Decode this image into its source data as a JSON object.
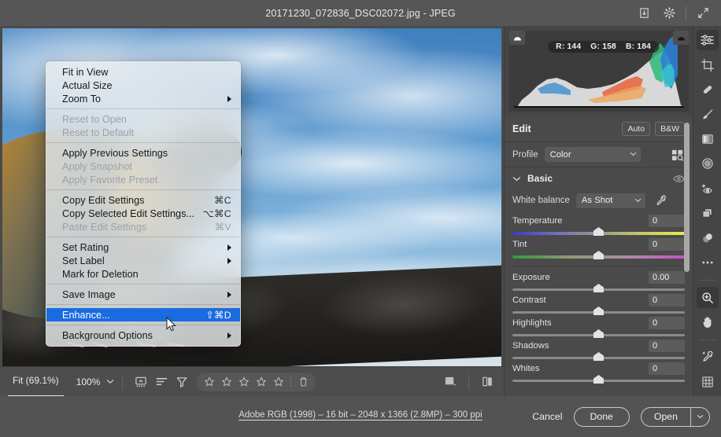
{
  "titlebar": {
    "title": "20171230_072836_DSC02072.jpg  -  JPEG",
    "icons": [
      "save-icon",
      "gear-icon",
      "expand-icon"
    ]
  },
  "context_menu": {
    "items": [
      {
        "label": "Fit in View",
        "shortcut": "",
        "disabled": false,
        "submenu": false,
        "selected": false
      },
      {
        "label": "Actual Size",
        "shortcut": "",
        "disabled": false,
        "submenu": false,
        "selected": false
      },
      {
        "label": "Zoom To",
        "shortcut": "",
        "disabled": false,
        "submenu": true,
        "selected": false
      },
      {
        "separator": true
      },
      {
        "label": "Reset to Open",
        "shortcut": "",
        "disabled": true,
        "submenu": false,
        "selected": false
      },
      {
        "label": "Reset to Default",
        "shortcut": "",
        "disabled": true,
        "submenu": false,
        "selected": false
      },
      {
        "separator": true
      },
      {
        "label": "Apply Previous Settings",
        "shortcut": "",
        "disabled": false,
        "submenu": false,
        "selected": false
      },
      {
        "label": "Apply Snapshot",
        "shortcut": "",
        "disabled": true,
        "submenu": false,
        "selected": false
      },
      {
        "label": "Apply Favorite Preset",
        "shortcut": "",
        "disabled": true,
        "submenu": false,
        "selected": false
      },
      {
        "separator": true
      },
      {
        "label": "Copy Edit Settings",
        "shortcut": "⌘C",
        "disabled": false,
        "submenu": false,
        "selected": false
      },
      {
        "label": "Copy Selected Edit Settings...",
        "shortcut": "⌥⌘C",
        "disabled": false,
        "submenu": false,
        "selected": false
      },
      {
        "label": "Paste Edit Settings",
        "shortcut": "⌘V",
        "disabled": true,
        "submenu": false,
        "selected": false
      },
      {
        "separator": true
      },
      {
        "label": "Set Rating",
        "shortcut": "",
        "disabled": false,
        "submenu": true,
        "selected": false
      },
      {
        "label": "Set Label",
        "shortcut": "",
        "disabled": false,
        "submenu": true,
        "selected": false
      },
      {
        "label": "Mark for Deletion",
        "shortcut": "",
        "disabled": false,
        "submenu": false,
        "selected": false
      },
      {
        "separator": true
      },
      {
        "label": "Save Image",
        "shortcut": "",
        "disabled": false,
        "submenu": true,
        "selected": false
      },
      {
        "separator": true
      },
      {
        "label": "Enhance...",
        "shortcut": "⇧⌘D",
        "disabled": false,
        "submenu": false,
        "selected": true
      },
      {
        "separator": true
      },
      {
        "label": "Background Options",
        "shortcut": "",
        "disabled": false,
        "submenu": true,
        "selected": false
      }
    ],
    "highlight_color": "#1a6be0"
  },
  "image_toolbar": {
    "fit_label": "Fit (69.1%)",
    "zoom_value": "100%",
    "icons": [
      "fullscreen-toggle-icon",
      "sort-icon",
      "filter-icon",
      "trash-icon",
      "fill-view-icon",
      "before-after-icon"
    ],
    "stars": 5,
    "rating": 0
  },
  "histogram": {
    "readout": {
      "r_label": "R: 144",
      "g_label": "G: 158",
      "b_label": "B: 184"
    },
    "rgb": {
      "r": 144,
      "g": 158,
      "b": 184
    },
    "shadow_clip_icon": "shadow-clipping-icon",
    "highlight_clip_icon": "highlight-clipping-icon"
  },
  "edit_panel": {
    "title": "Edit",
    "auto_label": "Auto",
    "bw_label": "B&W",
    "profile_label": "Profile",
    "profile_value": "Color",
    "browse_profiles_icon": "profile-browser-icon",
    "section": {
      "name": "Basic",
      "expanded": true,
      "visibility_icon": "eye-icon"
    },
    "white_balance_label": "White balance",
    "white_balance_value": "As Shot",
    "eyedropper_icon": "eyedropper-icon",
    "sliders": [
      {
        "name": "Temperature",
        "value": "0",
        "pos": 50,
        "track": "temp"
      },
      {
        "name": "Tint",
        "value": "0",
        "pos": 50,
        "track": "tint"
      },
      {
        "name": "Exposure",
        "value": "0.00",
        "pos": 50,
        "track": "plain"
      },
      {
        "name": "Contrast",
        "value": "0",
        "pos": 50,
        "track": "plain"
      },
      {
        "name": "Highlights",
        "value": "0",
        "pos": 50,
        "track": "plain"
      },
      {
        "name": "Shadows",
        "value": "0",
        "pos": 50,
        "track": "plain"
      },
      {
        "name": "Whites",
        "value": "0",
        "pos": 50,
        "track": "plain"
      }
    ]
  },
  "tool_rail": {
    "tools": [
      {
        "icon": "edit-sliders-icon",
        "active": true
      },
      {
        "icon": "crop-icon",
        "active": false
      },
      {
        "icon": "healing-brush-icon",
        "active": false
      },
      {
        "icon": "adjustment-brush-icon",
        "active": false
      },
      {
        "icon": "linear-gradient-icon",
        "active": false
      },
      {
        "icon": "radial-gradient-icon",
        "active": false
      },
      {
        "icon": "red-eye-icon",
        "active": false
      },
      {
        "icon": "snapshots-icon",
        "active": false
      },
      {
        "icon": "presets-icon",
        "active": false
      },
      {
        "icon": "more-options-icon",
        "active": false
      },
      {
        "icon": "zoom-tool-icon",
        "active": true
      },
      {
        "icon": "hand-tool-icon",
        "active": false
      },
      {
        "icon": "white-balance-tool-icon",
        "active": false
      },
      {
        "icon": "grid-overlay-icon",
        "active": false
      }
    ]
  },
  "status_bar": {
    "metadata": "Adobe RGB (1998) – 16 bit – 2048 x 1366 (2.8MP) – 300 ppi",
    "cancel_label": "Cancel",
    "done_label": "Done",
    "open_label": "Open"
  }
}
